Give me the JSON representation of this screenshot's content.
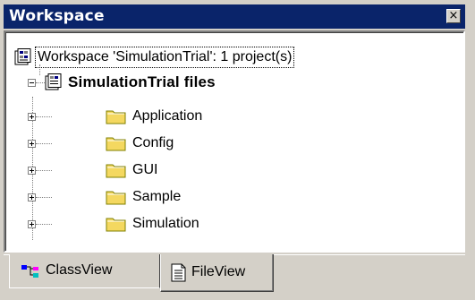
{
  "window": {
    "title": "Workspace",
    "close_glyph": "×"
  },
  "tree": {
    "root_label": "Workspace 'SimulationTrial': 1 project(s)",
    "project_label": "SimulationTrial files",
    "folders": [
      {
        "label": "Application",
        "icon": "folder-icon"
      },
      {
        "label": "Config",
        "icon": "folder-icon"
      },
      {
        "label": "GUI",
        "icon": "folder-icon"
      },
      {
        "label": "Sample",
        "icon": "folder-icon"
      },
      {
        "label": "Simulation",
        "icon": "folder-icon"
      }
    ]
  },
  "tabs": [
    {
      "label": "ClassView",
      "icon": "classview-icon",
      "selected": false
    },
    {
      "label": "FileView",
      "icon": "fileview-icon",
      "selected": true
    }
  ],
  "colors": {
    "titlebar": "#0a246a",
    "face": "#d4d0c8",
    "folder": "#f4d860"
  }
}
